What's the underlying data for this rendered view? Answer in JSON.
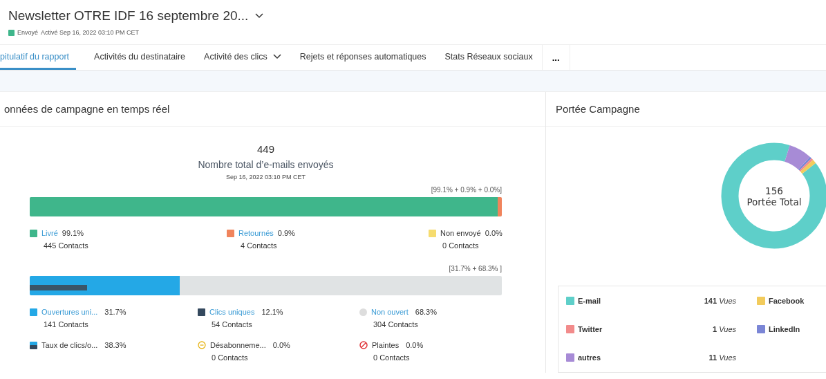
{
  "header": {
    "title": "Newsletter OTRE IDF 16 septembre 20...",
    "status": "Envoyé",
    "activated": "Activé Sep 16, 2022 03:10 PM CET"
  },
  "tabs": [
    {
      "label": "pitulatif du rapport",
      "selected": true,
      "dropdown": false
    },
    {
      "label": "Activités du destinataire",
      "selected": false,
      "dropdown": false
    },
    {
      "label": "Activité des clics",
      "selected": false,
      "dropdown": true
    },
    {
      "label": "Rejets et réponses automatiques",
      "selected": false,
      "dropdown": false
    },
    {
      "label": "Stats Réseaux sociaux",
      "selected": false,
      "dropdown": false
    }
  ],
  "more_label": "...",
  "left_panel": {
    "title": "onnées de campagne en temps réel",
    "total": "449",
    "total_label": "Nombre total d’e-mails envoyés",
    "date": "Sep 16, 2022 03:10 PM CET",
    "delivery_summary": "[99.1% + 0.9% + 0.0%]",
    "delivery_bar": [
      {
        "color": "#3fb68b",
        "level": 0.991
      },
      {
        "color": "#f0845c",
        "level": 0.009
      }
    ],
    "delivery_legend": [
      {
        "label": "Livré",
        "link": true,
        "value": "99.1%",
        "contacts": "445 Contacts",
        "color": "#3fb68b"
      },
      {
        "label": "Retournés",
        "link": true,
        "value": "0.9%",
        "contacts": "4 Contacts",
        "color": "#f0845c"
      },
      {
        "label": "Non envoyé",
        "link": false,
        "value": "0.0%",
        "contacts": "0 Contacts",
        "color": "#f6dc6f"
      }
    ],
    "open_summary": "[31.7% + 68.3% ]",
    "open_bar": [
      {
        "kind": "opens",
        "level": 0.317
      },
      {
        "kind": "clicks",
        "level": 0.121
      }
    ],
    "open_legend": [
      {
        "kind": "square",
        "label": "Ouvertures uni...",
        "link": true,
        "value": "31.7%",
        "contacts": "141 Contacts",
        "color": "#24a8e6"
      },
      {
        "kind": "square",
        "label": "Clics uniques",
        "link": true,
        "value": "12.1%",
        "contacts": "54 Contacts",
        "color": "#34495e"
      },
      {
        "kind": "dot",
        "label": "Non ouvert",
        "link": true,
        "value": "68.3%",
        "contacts": "304 Contacts",
        "color": "#dddddd"
      },
      {
        "kind": "split",
        "label": "Taux de clics/o...",
        "link": false,
        "value": "38.3%"
      },
      {
        "kind": "unsubscribe",
        "label": "Désabonneme...",
        "link": false,
        "value": "0.0%",
        "contacts": "0 Contacts"
      },
      {
        "kind": "complaint",
        "label": "Plaintes",
        "link": false,
        "value": "0.0%",
        "contacts": "0 Contacts"
      }
    ]
  },
  "right_panel": {
    "title": "Portée Campagne",
    "center_value": "156",
    "center_label": "Portée Total",
    "legend": [
      {
        "label": "E-mail",
        "color": "#5ecfc9",
        "count": "141",
        "unit": "Vues"
      },
      {
        "label": "Facebook",
        "color": "#f2cb5c"
      },
      {
        "label": "Twitter",
        "color": "#f28b8b",
        "count": "1",
        "unit": "Vues"
      },
      {
        "label": "LinkedIn",
        "color": "#7b86d6"
      },
      {
        "label": "autres",
        "color": "#a78bd6",
        "count": "11",
        "unit": "Vues"
      }
    ]
  }
}
